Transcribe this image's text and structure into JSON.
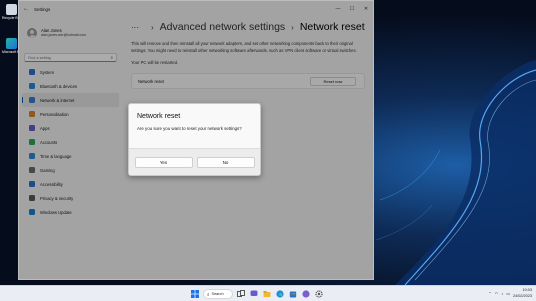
{
  "desktop": {
    "icons": [
      {
        "label": "Recycle Bin",
        "icon": "recycle-bin-icon"
      },
      {
        "label": "Microsoft Edge",
        "icon": "edge-icon"
      }
    ]
  },
  "window": {
    "app_title": "Settings",
    "back_glyph": "←",
    "controls": {
      "minimize": "—",
      "maximize": "☐",
      "close": "✕"
    }
  },
  "profile": {
    "name": "Alan Jones",
    "email": "alan.jones.wer@hotmail.com"
  },
  "search": {
    "placeholder": "Find a setting",
    "icon": "search-icon"
  },
  "nav": [
    {
      "label": "System",
      "color": "#2f6fd6"
    },
    {
      "label": "Bluetooth & devices",
      "color": "#2a86d9"
    },
    {
      "label": "Network & internet",
      "color": "#3a7dd4",
      "active": true
    },
    {
      "label": "Personalisation",
      "color": "#d9822b"
    },
    {
      "label": "Apps",
      "color": "#6b5bc7"
    },
    {
      "label": "Accounts",
      "color": "#2fa55a"
    },
    {
      "label": "Time & language",
      "color": "#2d89d6"
    },
    {
      "label": "Gaming",
      "color": "#6c6c6c"
    },
    {
      "label": "Accessibility",
      "color": "#2b73c9"
    },
    {
      "label": "Privacy & security",
      "color": "#5a5a5a"
    },
    {
      "label": "Windows Update",
      "color": "#1c7fd4"
    }
  ],
  "breadcrumb": {
    "overflow": "···",
    "separator": "›",
    "parent": "Advanced network settings",
    "current": "Network reset"
  },
  "content": {
    "description": "This will remove and then reinstall all your network adapters, and set other networking components back to their original settings. You might need to reinstall other networking software afterwards, such as VPN client software or virtual switches.",
    "restart_note": "Your PC will be restarted.",
    "reset_row_label": "Network reset",
    "reset_button": "Reset now"
  },
  "dialog": {
    "title": "Network reset",
    "message": "Are you sure you want to reset your network settings?",
    "yes": "Yes",
    "no": "No"
  },
  "taskbar": {
    "search_label": "Search",
    "clock_time": "10:03",
    "clock_date": "24/02/2023"
  },
  "colors": {
    "accent": "#005fb8",
    "window_bg": "#f3f3f3",
    "taskbar_bg": "#eaeef4"
  }
}
